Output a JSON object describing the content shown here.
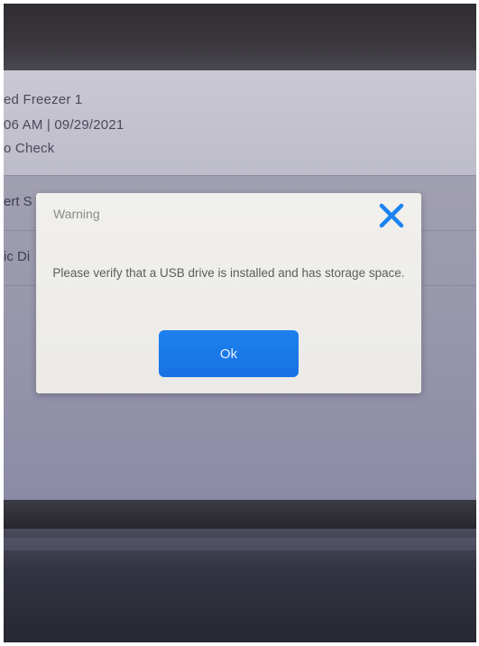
{
  "background": {
    "lines": [
      "ed Freezer 1",
      "06 AM | 09/29/2021",
      "o Check"
    ],
    "row_labels": [
      "ert S",
      "ic Di"
    ]
  },
  "dialog": {
    "title": "Warning",
    "message": "Please verify that a USB drive is installed and has storage space.",
    "ok_label": "Ok",
    "close_icon": "close-icon"
  },
  "colors": {
    "accent": "#1a7aea",
    "close_icon": "#1c84f0",
    "dialog_bg": "#eeede9"
  }
}
